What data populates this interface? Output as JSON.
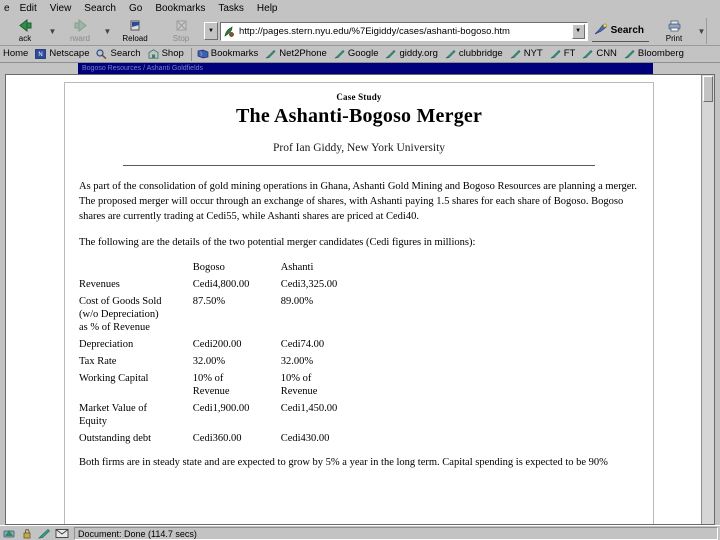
{
  "window": {
    "menu_items": [
      {
        "label": "e"
      },
      {
        "label": "Edit"
      },
      {
        "label": "View"
      },
      {
        "label": "Search"
      },
      {
        "label": "Go"
      },
      {
        "label": "Bookmarks"
      },
      {
        "label": "Tasks"
      },
      {
        "label": "Help"
      }
    ]
  },
  "toolbar": {
    "buttons": [
      {
        "label": "ack",
        "icon": "back-arrow-icon",
        "glyph": "◀",
        "dim": false
      },
      {
        "label": "rward",
        "icon": "forward-arrow-icon",
        "glyph": "▶",
        "dim": true
      },
      {
        "label": "Reload",
        "icon": "reload-icon",
        "glyph": "↻",
        "dim": false
      },
      {
        "label": "Stop",
        "icon": "stop-icon",
        "glyph": "✖",
        "dim": true
      }
    ],
    "dropdown_caret": "▼",
    "search_label": "Search",
    "search_icon": "search-icon",
    "print_label": "Print",
    "print_icon": "printer-icon",
    "print_caret": "▼"
  },
  "address_bar": {
    "url": "http://pages.stern.nyu.edu/%7Eigiddy/cases/ashanti-bogoso.htm",
    "favicon": "page-icon",
    "dropdown_caret": "▼"
  },
  "personal_toolbar": {
    "items": [
      {
        "label": "Home",
        "icon": "home-icon"
      },
      {
        "label": "Netscape",
        "icon": "netscape-icon"
      },
      {
        "label": "Search",
        "icon": "search-icon"
      },
      {
        "label": "Shop",
        "icon": "shop-icon"
      },
      {
        "label": "Bookmarks",
        "icon": "bookmarks-icon"
      },
      {
        "label": "Net2Phone",
        "icon": "bookmark-pencil-icon"
      },
      {
        "label": "Google",
        "icon": "bookmark-pencil-icon"
      },
      {
        "label": "giddy.org",
        "icon": "bookmark-pencil-icon"
      },
      {
        "label": "clubbridge",
        "icon": "bookmark-pencil-icon"
      },
      {
        "label": "NYT",
        "icon": "bookmark-pencil-icon"
      },
      {
        "label": "FT",
        "icon": "bookmark-pencil-icon"
      },
      {
        "label": "CNN",
        "icon": "bookmark-pencil-icon"
      },
      {
        "label": "Bloomberg",
        "icon": "bookmark-pencil-icon"
      }
    ]
  },
  "page_banner": {
    "text": "Bogoso Resources / Ashanti Goldfields"
  },
  "document": {
    "kicker": "Case Study",
    "title": "The Ashanti-Bogoso Merger",
    "byline": "Prof Ian Giddy, New York University",
    "paragraph1": "As part of the consolidation of gold mining operations in Ghana, Ashanti Gold Mining and Bogoso Resources are planning a merger. The proposed merger will occur through an exchange of shares, with Ashanti paying 1.5 shares for each share of Bogoso. Bogoso shares are currently trading at Cedi55, while Ashanti shares are priced at Cedi40.",
    "paragraph2": "The following are the details of the two potential merger candidates (Cedi figures in millions):",
    "table": {
      "headers": [
        "",
        "Bogoso",
        "Ashanti"
      ],
      "rows": [
        {
          "label": "Revenues",
          "bogoso": "Cedi4,800.00",
          "ashanti": "Cedi3,325.00"
        },
        {
          "label": "Cost of Goods Sold\n(w/o Depreciation)\nas % of Revenue",
          "bogoso": "87.50%",
          "ashanti": "89.00%"
        },
        {
          "label": "Depreciation",
          "bogoso": "Cedi200.00",
          "ashanti": "Cedi74.00"
        },
        {
          "label": "Tax Rate",
          "bogoso": "32.00%",
          "ashanti": "32.00%"
        },
        {
          "label": "Working Capital",
          "bogoso": "10% of\nRevenue",
          "ashanti": "10% of\nRevenue"
        },
        {
          "label": "Market Value of\nEquity",
          "bogoso": "Cedi1,900.00",
          "ashanti": "Cedi1,450.00"
        },
        {
          "label": "Outstanding debt",
          "bogoso": "Cedi360.00",
          "ashanti": "Cedi430.00"
        }
      ]
    },
    "paragraph3": "Both firms are in steady state and are expected to grow by 5% a year in the long term. Capital spending is expected to be 90%"
  },
  "status_bar": {
    "message": "Document: Done (114.7 secs)",
    "icons": [
      "online-icon",
      "security-icon",
      "compose-icon",
      "mail-icon"
    ]
  },
  "colors": {
    "chrome": "#c3c3c3",
    "banner_blue": "#00007a",
    "page_white": "#ffffff",
    "desktop": "#c0c0c0"
  }
}
